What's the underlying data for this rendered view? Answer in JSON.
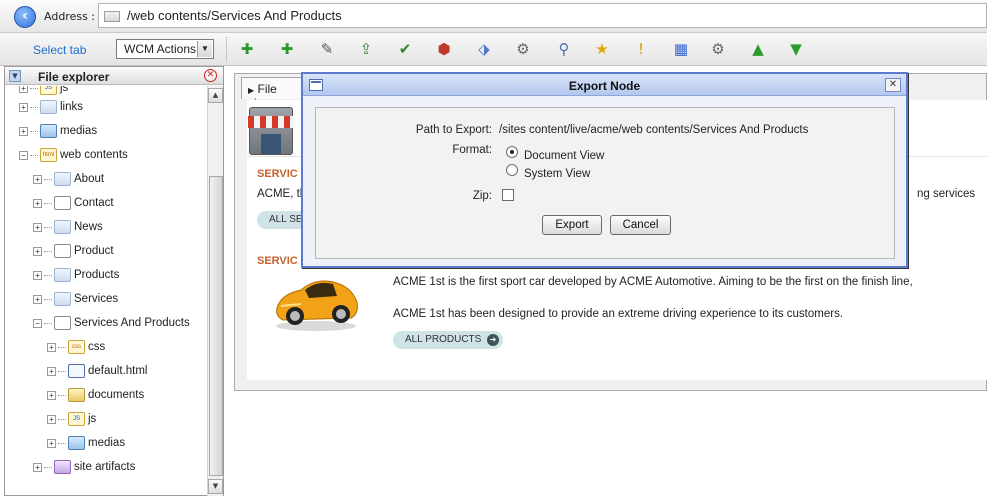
{
  "address": {
    "label": "Address :",
    "path": "/web contents/Services And Products"
  },
  "toolbar": {
    "select_tab": "Select tab",
    "actions_select": "WCM Actions",
    "icons": [
      "add-node-icon",
      "add-item-icon",
      "edit-icon",
      "upload-icon",
      "approve-icon",
      "tag-icon",
      "publish-icon",
      "settings-icon",
      "link-icon",
      "favorite-icon",
      "warning-icon",
      "windows-icon",
      "properties-icon",
      "move-up-icon",
      "move-down-icon"
    ]
  },
  "sidebar": {
    "title": "File explorer",
    "items": [
      {
        "label": "js",
        "icon": "js",
        "depth": 0
      },
      {
        "label": "links",
        "icon": "folder",
        "depth": 0
      },
      {
        "label": "medias",
        "icon": "media",
        "depth": 0
      },
      {
        "label": "web contents",
        "icon": "html",
        "depth": 0,
        "expanded": true
      },
      {
        "label": "About",
        "icon": "folder",
        "depth": 1
      },
      {
        "label": "Contact",
        "icon": "page",
        "depth": 1
      },
      {
        "label": "News",
        "icon": "folder",
        "depth": 1
      },
      {
        "label": "Product",
        "icon": "page",
        "depth": 1
      },
      {
        "label": "Products",
        "icon": "folder",
        "depth": 1
      },
      {
        "label": "Services",
        "icon": "folder",
        "depth": 1
      },
      {
        "label": "Services And Products",
        "icon": "page",
        "depth": 1,
        "expanded": true
      },
      {
        "label": "css",
        "icon": "css",
        "depth": 2
      },
      {
        "label": "default.html",
        "icon": "doc",
        "depth": 2
      },
      {
        "label": "documents",
        "icon": "yfolder",
        "depth": 2
      },
      {
        "label": "js",
        "icon": "js",
        "depth": 2
      },
      {
        "label": "medias",
        "icon": "media",
        "depth": 2
      },
      {
        "label": "site artifacts",
        "icon": "pfolder",
        "depth": 1
      }
    ]
  },
  "main": {
    "tab_label": "File view",
    "section1_title": "SERVIC",
    "section1_text_a": "ACME, th",
    "section1_text_b": "ng services",
    "section1_button": "ALL SE",
    "section2_title": "SERVIC",
    "car_line1": "ACME 1st is the first sport car developed by ACME Automotive. Aiming to be the first on the finish line,",
    "car_line2": "ACME 1st has been designed to provide an extreme driving experience to its customers.",
    "all_products": "ALL PRODUCTS"
  },
  "dialog": {
    "title": "Export Node",
    "path_label": "Path to Export:",
    "path_value": "/sites content/live/acme/web contents/Services And Products",
    "format_label": "Format:",
    "format_options": [
      "Document View",
      "System View"
    ],
    "format_selected": "Document View",
    "zip_label": "Zip:",
    "zip_checked": false,
    "export_button": "Export",
    "cancel_button": "Cancel"
  }
}
